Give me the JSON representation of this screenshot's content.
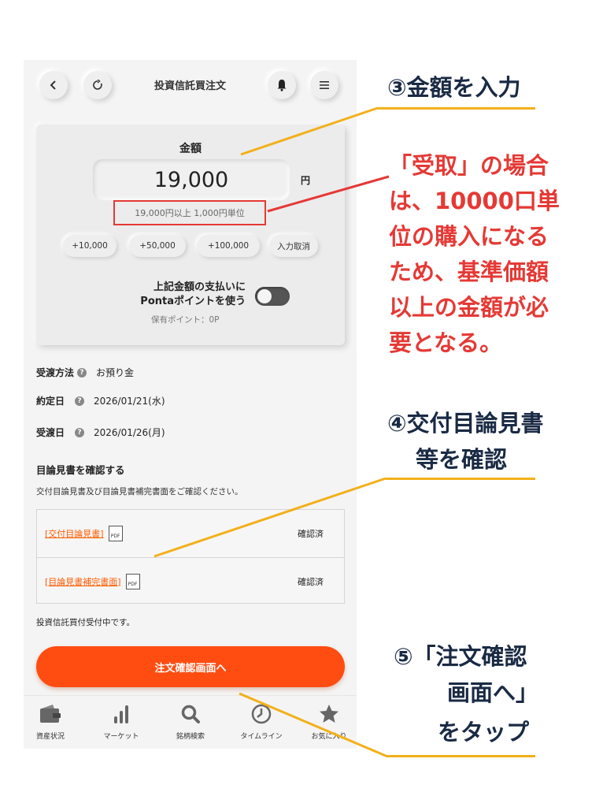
{
  "header": {
    "title": "投資信託買注文",
    "back_icon": "chevron-left-icon",
    "refresh_icon": "refresh-icon",
    "bell_icon": "bell-icon",
    "menu_icon": "hamburger-menu-icon"
  },
  "amount": {
    "label": "金額",
    "value": "19,000",
    "unit": "円",
    "note": "19,000円以上 1,000円単位"
  },
  "quick_buttons": [
    "+10,000",
    "+50,000",
    "+100,000",
    "入力取消"
  ],
  "ponta": {
    "text_line1": "上記金額の支払いに",
    "text_line2": "Pontaポイントを使う",
    "points": "保有ポイント：0P",
    "toggle_on": false
  },
  "info": {
    "delivery_method_label": "受渡方法",
    "delivery_method_value": "お預り金",
    "contract_date_label": "約定日",
    "contract_date_value": "2026/01/21(水)",
    "delivery_date_label": "受渡日",
    "delivery_date_value": "2026/01/26(月)"
  },
  "documents": {
    "title": "目論見書を確認する",
    "subtitle": "交付目論見書及び目論見書補完書面をご確認ください。",
    "rows": [
      {
        "link": "[交付目論見書]",
        "status": "確認済"
      },
      {
        "link": "[目論見書補完書面]",
        "status": "確認済"
      }
    ],
    "pdf_label": "PDF",
    "accepting": "投資信託買付受付中です。"
  },
  "order_button": "注文確認画面へ",
  "tabs": [
    {
      "label": "資産状況",
      "icon": "wallet-icon"
    },
    {
      "label": "マーケット",
      "icon": "bar-chart-icon"
    },
    {
      "label": "銘柄検索",
      "icon": "search-icon"
    },
    {
      "label": "タイムライン",
      "icon": "clock-icon"
    },
    {
      "label": "お気に入り",
      "icon": "star-icon"
    }
  ],
  "annotations": {
    "step3": "③金額を入力",
    "red_note": [
      "「受取」の場合",
      "は、10000口単",
      "位の購入になる",
      "ため、基準価額",
      "以上の金額が必",
      "要となる。"
    ],
    "step4_line1": "④交付目論見書",
    "step4_line2": "等を確認",
    "step5_line1": "⑤「注文確認",
    "step5_line2": "画面へ」",
    "step5_line3": "をタップ"
  },
  "colors": {
    "accent": "#ff4d12",
    "annotation_line": "#f2b01a",
    "annotation_red": "#e53935",
    "annotation_dark": "#1a2a44"
  }
}
